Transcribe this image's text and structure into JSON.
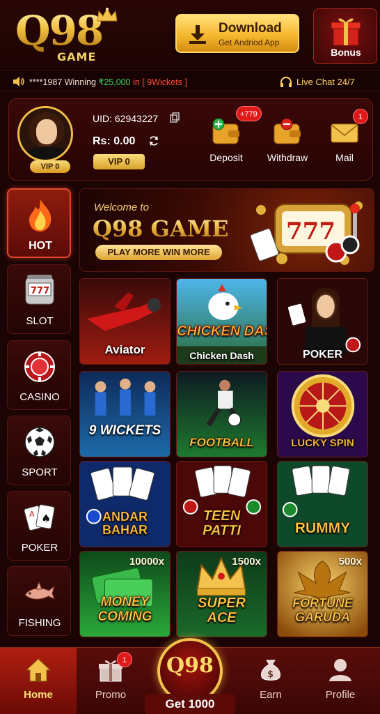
{
  "header": {
    "logo_text": "Q98",
    "logo_sub": "GAME",
    "download_title": "Download",
    "download_sub": "Get Andriod App",
    "bonus_label": "Bonus"
  },
  "ticker": {
    "user": "****1987 Winning",
    "amount": "₹25,000",
    "in_word": "in",
    "game": "[ 9Wickets ]",
    "live_chat": "Live Chat 24/7"
  },
  "account": {
    "uid": "UID: 62943227",
    "balance": "Rs: 0.00",
    "vip_tag": "VIP 0",
    "vip_button": "VIP 0",
    "actions": [
      {
        "label": "Deposit",
        "badge": "+779",
        "icon": "wallet-plus-icon"
      },
      {
        "label": "Withdraw",
        "icon": "wallet-minus-icon"
      },
      {
        "label": "Mail",
        "badge": "1",
        "icon": "mail-icon"
      }
    ]
  },
  "sidebar": {
    "items": [
      {
        "label": "HOT",
        "icon": "fire-icon",
        "active": true
      },
      {
        "label": "SLOT",
        "icon": "slot-machine-icon"
      },
      {
        "label": "CASINO",
        "icon": "casino-chip-icon"
      },
      {
        "label": "SPORT",
        "icon": "soccer-ball-icon"
      },
      {
        "label": "POKER",
        "icon": "playing-cards-icon"
      },
      {
        "label": "FISHING",
        "icon": "shark-icon"
      }
    ]
  },
  "banner": {
    "welcome": "Welcome to",
    "title": "Q98 GAME",
    "tagline": "PLAY MORE WIN MORE",
    "reels": "777"
  },
  "games": [
    {
      "title": "Aviator"
    },
    {
      "title": "Chicken Dash",
      "logo": "CHICKEN DASH"
    },
    {
      "title": "POKER"
    },
    {
      "title": "9 WICKETS"
    },
    {
      "title": "FOOTBALL"
    },
    {
      "title": "LUCKY SPIN"
    },
    {
      "title": "ANDAR BAHAR"
    },
    {
      "title": "TEEN PATTI"
    },
    {
      "title": "RUMMY"
    },
    {
      "title": "MONEY COMING",
      "multiplier": "10000x"
    },
    {
      "title": "SUPER ACE",
      "multiplier": "1500x"
    },
    {
      "title": "FORTUNE GARUDA",
      "multiplier": "500x"
    }
  ],
  "bottom_nav": {
    "home": "Home",
    "promo": "Promo",
    "promo_badge": "1",
    "center_logo": "Q98",
    "center_label": "Get 1000",
    "earn": "Earn",
    "profile": "Profile"
  },
  "colors": {
    "background": "#1a0404",
    "gold": "#f2c24c",
    "accent_red": "#e01818",
    "win_green": "#3fd25a"
  }
}
